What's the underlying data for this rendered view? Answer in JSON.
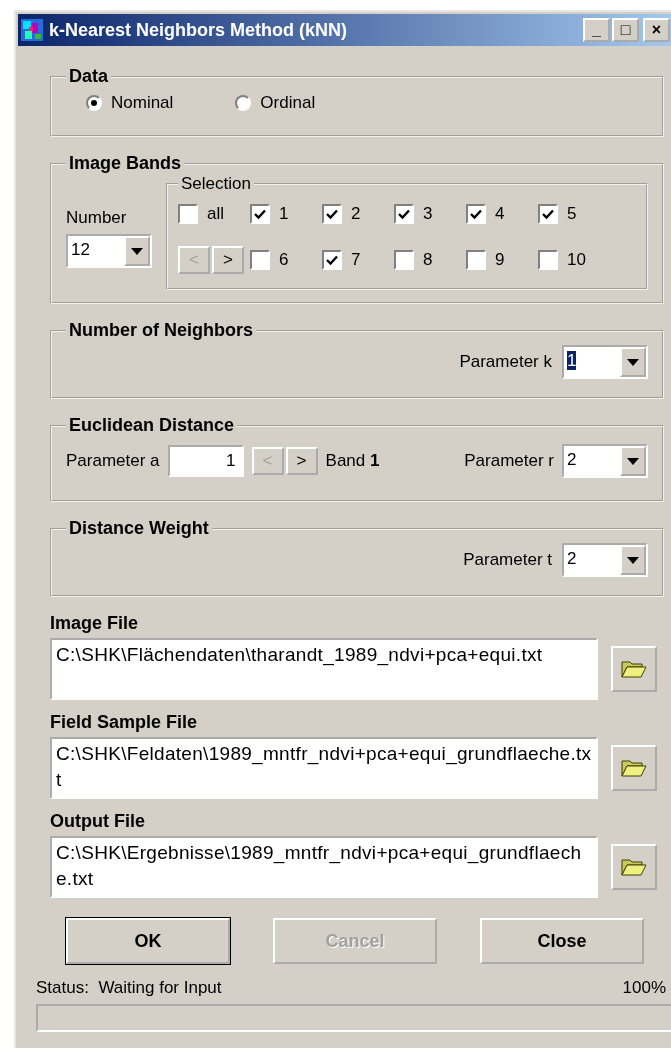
{
  "window": {
    "title": "k-Nearest Neighbors Method (kNN)",
    "controls": [
      "_",
      "□",
      "×"
    ]
  },
  "data_group": {
    "title": "Data",
    "options": [
      {
        "label": "Nominal",
        "selected": true
      },
      {
        "label": "Ordinal",
        "selected": false
      }
    ]
  },
  "image_bands": {
    "title": "Image Bands",
    "number": {
      "label": "Number",
      "value": "12"
    },
    "selection": {
      "title": "Selection",
      "bands": [
        {
          "label": "all",
          "checked": false
        },
        {
          "label": "1",
          "checked": true
        },
        {
          "label": "2",
          "checked": true
        },
        {
          "label": "3",
          "checked": true
        },
        {
          "label": "4",
          "checked": true
        },
        {
          "label": "5",
          "checked": true
        },
        {
          "label": "6",
          "checked": false
        },
        {
          "label": "7",
          "checked": true
        },
        {
          "label": "8",
          "checked": false
        },
        {
          "label": "9",
          "checked": false
        },
        {
          "label": "10",
          "checked": false
        }
      ],
      "nav_buttons": [
        {
          "label": "<",
          "disabled": true
        },
        {
          "label": ">",
          "disabled": false
        }
      ]
    }
  },
  "neighbors": {
    "title": "Number of Neighbors",
    "label": "Parameter k",
    "value": "1",
    "value_highlighted": true
  },
  "euclidean": {
    "title": "Euclidean Distance",
    "a_label": "Parameter a",
    "a_value": "1",
    "nav_buttons": [
      {
        "label": "<",
        "disabled": true
      },
      {
        "label": ">",
        "disabled": false
      }
    ],
    "band": "Band **1**",
    "r_label": "Parameter r",
    "r_value": "2"
  },
  "distance_weight": {
    "title": "Distance Weight",
    "label": "Parameter t",
    "value": "2"
  },
  "files": [
    {
      "label": "Image File",
      "path": "C:\\SHK\\Flächendaten\\tharandt_1989_ndvi+pca+equi.txt"
    },
    {
      "label": "Field Sample File",
      "path": "C:\\SHK\\Feldaten\\1989_mntfr_ndvi+pca+equi_grundflaeche.txt"
    },
    {
      "label": "Output File",
      "path": "C:\\SHK\\Ergebnisse\\1989_mntfr_ndvi+pca+equi_grundflaeche.txt"
    }
  ],
  "buttons": [
    {
      "label": "OK",
      "disabled": false,
      "default": true
    },
    {
      "label": "Cancel",
      "disabled": true,
      "default": false
    },
    {
      "label": "Close",
      "disabled": false,
      "default": false
    }
  ],
  "status": {
    "label": "Status:",
    "text": "Waiting for Input",
    "percent": "100%"
  }
}
